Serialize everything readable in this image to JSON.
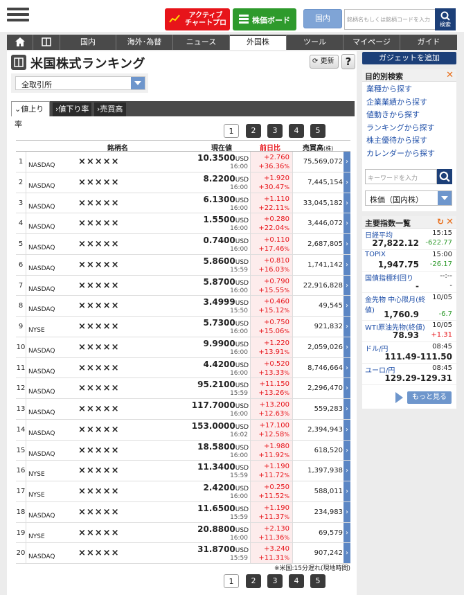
{
  "header": {
    "active_chart_label_1": "アクティブ",
    "active_chart_label_2": "チャートプロ",
    "board_label": "株価ボード",
    "domestic_label": "国内",
    "search_placeholder": "銘柄名もしくは銘柄コードを入力",
    "search_button_label": "検索"
  },
  "nav": {
    "items": [
      "国内",
      "海外･為替",
      "ニュース",
      "外国株",
      "ツール",
      "マイページ",
      "ガイド"
    ]
  },
  "page": {
    "title": "米国株式ランキング",
    "refresh_label": "更新",
    "help_label": "?",
    "exchange_selected": "全取引所",
    "tabs": [
      "値上り率",
      "値下り率",
      "売買高"
    ],
    "pages": [
      "1",
      "2",
      "3",
      "4",
      "5"
    ],
    "columns": {
      "name": "銘柄名",
      "price": "現在値",
      "change": "前日比",
      "volume": "売買高",
      "volume_unit": "(株)"
    },
    "note": "※米国:15分遅れ(現地時間)"
  },
  "rows": [
    {
      "rank": "1",
      "market": "NASDAQ",
      "name": "×××××",
      "price": "10.3500",
      "unit": "USD",
      "time": "16:00",
      "chg": "+2.760",
      "pct": "+36.36",
      "vol": "75,569,072"
    },
    {
      "rank": "2",
      "market": "NASDAQ",
      "name": "×××××",
      "price": "8.2200",
      "unit": "USD",
      "time": "16:00",
      "chg": "+1.920",
      "pct": "+30.47",
      "vol": "7,445,154"
    },
    {
      "rank": "3",
      "market": "NASDAQ",
      "name": "×××××",
      "price": "6.1300",
      "unit": "USD",
      "time": "16:00",
      "chg": "+1.110",
      "pct": "+22.11",
      "vol": "33,045,182"
    },
    {
      "rank": "4",
      "market": "NASDAQ",
      "name": "×××××",
      "price": "1.5500",
      "unit": "USD",
      "time": "16:00",
      "chg": "+0.280",
      "pct": "+22.04",
      "vol": "3,446,072"
    },
    {
      "rank": "5",
      "market": "NASDAQ",
      "name": "×××××",
      "price": "0.7400",
      "unit": "USD",
      "time": "16:00",
      "chg": "+0.110",
      "pct": "+17.46",
      "vol": "2,687,805"
    },
    {
      "rank": "6",
      "market": "NASDAQ",
      "name": "×××××",
      "price": "5.8600",
      "unit": "USD",
      "time": "15:59",
      "chg": "+0.810",
      "pct": "+16.03",
      "vol": "1,741,142"
    },
    {
      "rank": "7",
      "market": "NASDAQ",
      "name": "×××××",
      "price": "5.8700",
      "unit": "USD",
      "time": "16:00",
      "chg": "+0.790",
      "pct": "+15.55",
      "vol": "22,916,828"
    },
    {
      "rank": "8",
      "market": "NASDAQ",
      "name": "×××××",
      "price": "3.4999",
      "unit": "USD",
      "time": "15:50",
      "chg": "+0.460",
      "pct": "+15.12",
      "vol": "49,545"
    },
    {
      "rank": "9",
      "market": "NYSE",
      "name": "×××××",
      "price": "5.7300",
      "unit": "USD",
      "time": "16:00",
      "chg": "+0.750",
      "pct": "+15.06",
      "vol": "921,832"
    },
    {
      "rank": "10",
      "market": "NASDAQ",
      "name": "×××××",
      "price": "9.9900",
      "unit": "USD",
      "time": "16:00",
      "chg": "+1.220",
      "pct": "+13.91",
      "vol": "2,059,026"
    },
    {
      "rank": "11",
      "market": "NASDAQ",
      "name": "×××××",
      "price": "4.4200",
      "unit": "USD",
      "time": "16:00",
      "chg": "+0.520",
      "pct": "+13.33",
      "vol": "8,746,664"
    },
    {
      "rank": "12",
      "market": "NASDAQ",
      "name": "×××××",
      "price": "95.2100",
      "unit": "USD",
      "time": "15:59",
      "chg": "+11.150",
      "pct": "+13.26",
      "vol": "2,296,470"
    },
    {
      "rank": "13",
      "market": "NASDAQ",
      "name": "×××××",
      "price": "117.7000",
      "unit": "USD",
      "time": "16:00",
      "chg": "+13.200",
      "pct": "+12.63",
      "vol": "559,283"
    },
    {
      "rank": "14",
      "market": "NASDAQ",
      "name": "×××××",
      "price": "153.0000",
      "unit": "USD",
      "time": "16:02",
      "chg": "+17.100",
      "pct": "+12.58",
      "vol": "2,394,943"
    },
    {
      "rank": "15",
      "market": "NASDAQ",
      "name": "×××××",
      "price": "18.5800",
      "unit": "USD",
      "time": "16:00",
      "chg": "+1.980",
      "pct": "+11.92",
      "vol": "618,520"
    },
    {
      "rank": "16",
      "market": "NYSE",
      "name": "×××××",
      "price": "11.3400",
      "unit": "USD",
      "time": "15:59",
      "chg": "+1.190",
      "pct": "+11.72",
      "vol": "1,397,938"
    },
    {
      "rank": "17",
      "market": "NYSE",
      "name": "×××××",
      "price": "2.4200",
      "unit": "USD",
      "time": "16:00",
      "chg": "+0.250",
      "pct": "+11.52",
      "vol": "588,011"
    },
    {
      "rank": "18",
      "market": "NASDAQ",
      "name": "×××××",
      "price": "11.6500",
      "unit": "USD",
      "time": "15:59",
      "chg": "+1.190",
      "pct": "+11.37",
      "vol": "234,983"
    },
    {
      "rank": "19",
      "market": "NYSE",
      "name": "×××××",
      "price": "20.8800",
      "unit": "USD",
      "time": "16:00",
      "chg": "+2.130",
      "pct": "+11.36",
      "vol": "69,579"
    },
    {
      "rank": "20",
      "market": "NASDAQ",
      "name": "×××××",
      "price": "31.8700",
      "unit": "USD",
      "time": "15:59",
      "chg": "+3.240",
      "pct": "+11.31",
      "vol": "907,242"
    }
  ],
  "sidebar": {
    "gadget_label": "ガジェットを追加",
    "search_title": "目的別検索",
    "links": [
      "業種から探す",
      "企業業績から探す",
      "値動きから探す",
      "ランキングから探す",
      "株主優待から探す",
      "カレンダーから探す"
    ],
    "keyword_placeholder": "キーワードを入力",
    "scope_selected": "株価（国内株）",
    "index_title": "主要指数一覧",
    "indices": [
      {
        "name": "日経平均",
        "time": "15:15",
        "value": "27,822.12",
        "change": "-622.77",
        "color": "#2e9a2c"
      },
      {
        "name": "TOPIX",
        "time": "15:00",
        "value": "1,947.75",
        "change": "-26.17",
        "color": "#2e9a2c"
      },
      {
        "name": "国債指標利回り",
        "time": "--:--",
        "value": "-",
        "change": "-",
        "color": "#222222"
      },
      {
        "name": "金先物 中心限月(終値)",
        "time": "10/05",
        "value": "1,760.9",
        "change": "-6.7",
        "color": "#2e9a2c"
      },
      {
        "name": "WTI原油先物(終値)",
        "time": "10/05",
        "value": "78.93",
        "change": "+1.31",
        "color": "#e7141a"
      },
      {
        "name": "ドル/円",
        "time": "08:45",
        "value": "111.49-111.50",
        "change": "",
        "color": "#222222"
      },
      {
        "name": "ユーロ/円",
        "time": "08:45",
        "value": "129.29-129.31",
        "change": "",
        "color": "#222222"
      }
    ],
    "more_label": "もっと見る"
  },
  "colors": {
    "accent_blue": "#1c3f78",
    "up_red": "#e7141a",
    "down_green": "#2e9a2c",
    "nav_dark": "#4a4a4a"
  }
}
